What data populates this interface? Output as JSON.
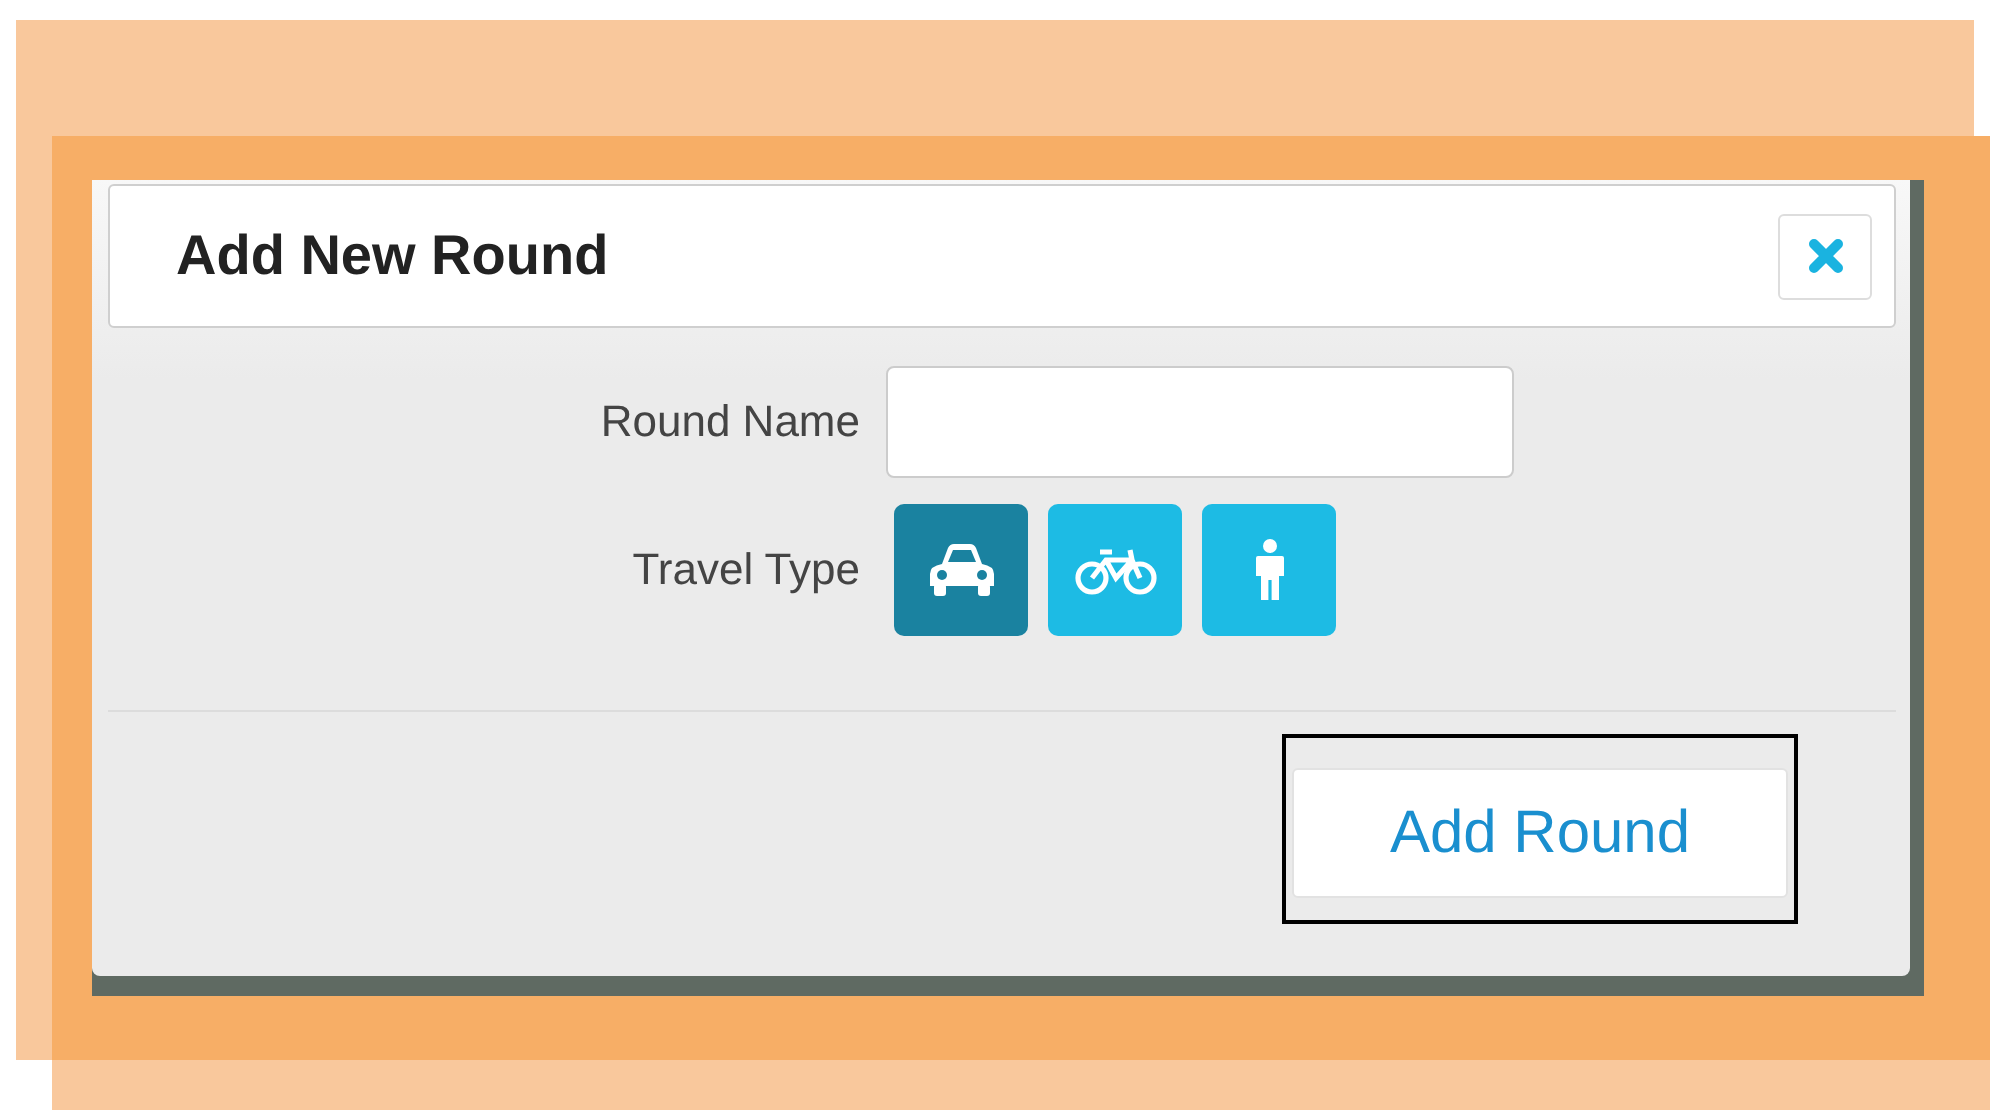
{
  "dialog": {
    "title": "Add New Round"
  },
  "form": {
    "round_name": {
      "label": "Round Name"
    },
    "travel_type": {
      "label": "Travel Type",
      "options": [
        {
          "kind": "car",
          "selected": true
        },
        {
          "kind": "bicycle",
          "selected": false
        },
        {
          "kind": "walk",
          "selected": false
        }
      ]
    }
  },
  "submit_button": {
    "label": "Add Round",
    "focused": true
  }
}
